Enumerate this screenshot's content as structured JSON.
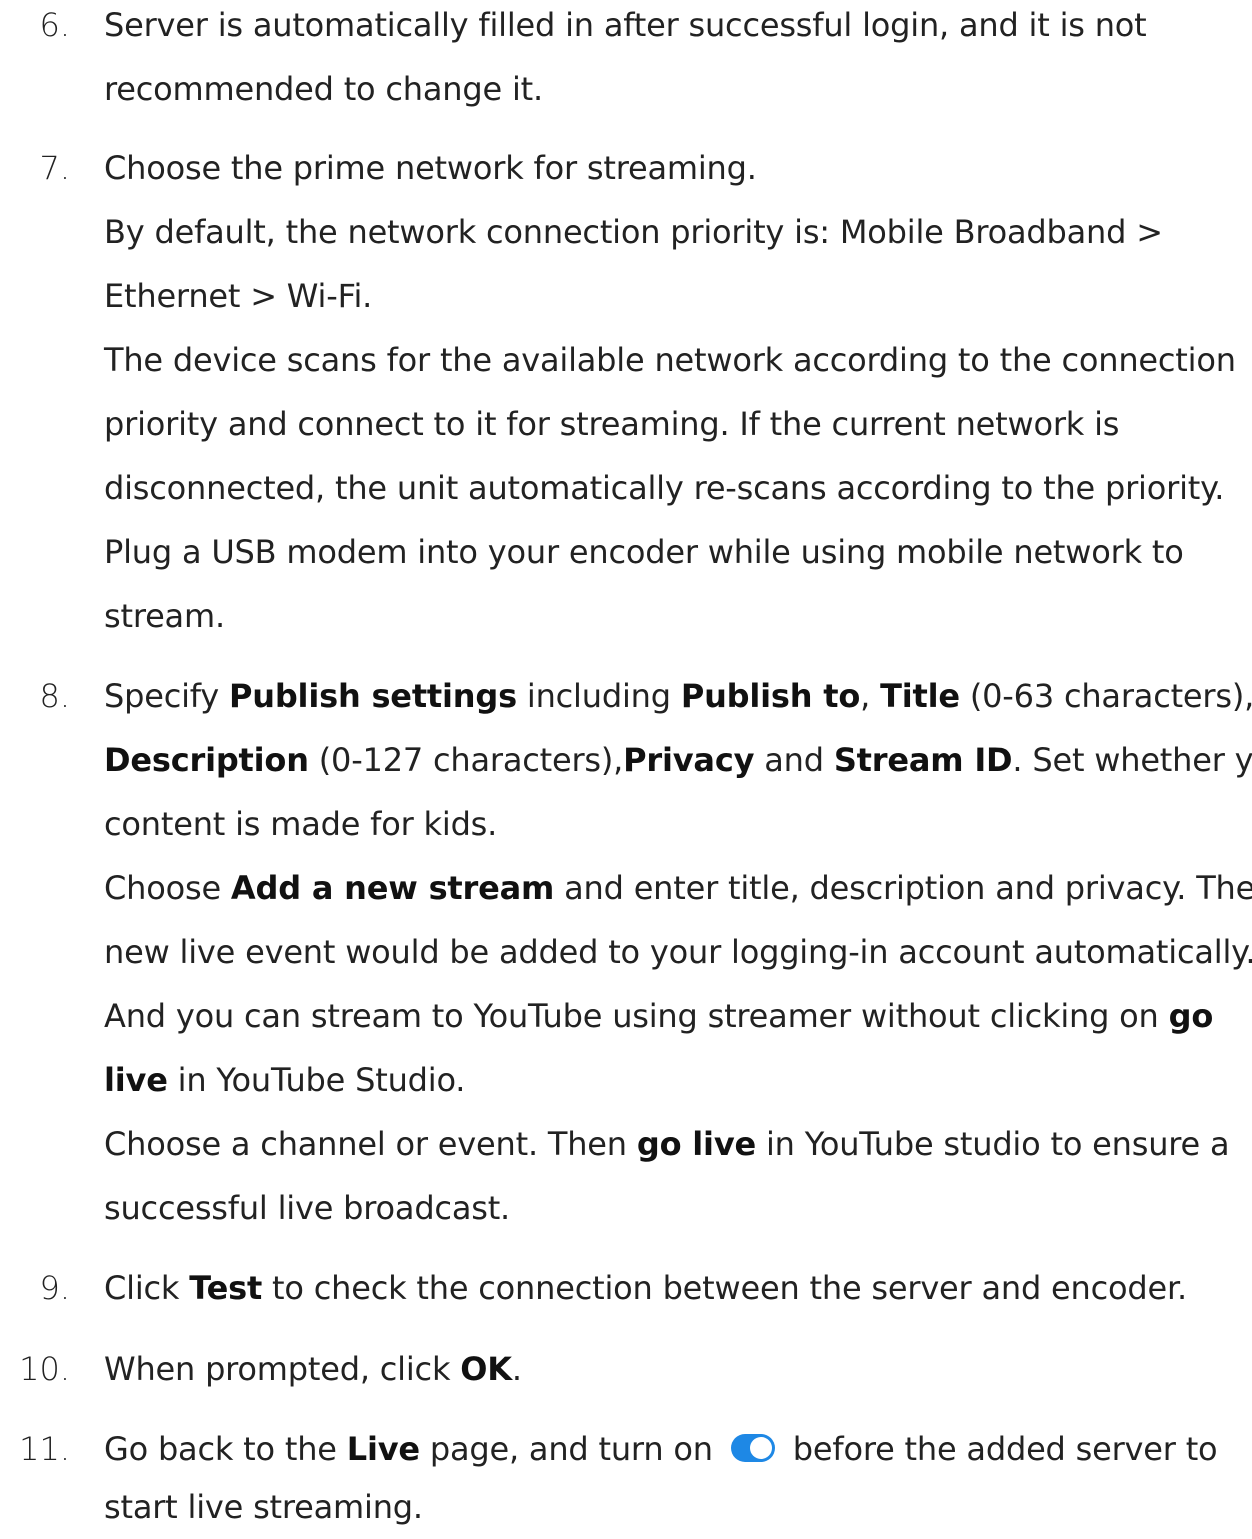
{
  "steps": [
    {
      "number": "6.",
      "lines": [
        {
          "text": "Server is automatically filled in after successful login, and it is not"
        },
        {
          "text": "recommended to change it."
        }
      ]
    },
    {
      "number": "7.",
      "lines": [
        {
          "text": "Choose the prime network for streaming."
        },
        {
          "text": "By default, the network connection priority is: Mobile Broadband >"
        },
        {
          "text": "Ethernet > Wi-Fi."
        },
        {
          "text": "The device scans for the available network according to the connection"
        },
        {
          "text": "priority and connect to it for streaming. If the current network is"
        },
        {
          "text": "disconnected, the unit automatically re-scans according to the priority."
        },
        {
          "text": "Plug a USB modem into your encoder while using mobile network to"
        },
        {
          "text": "stream."
        }
      ]
    },
    {
      "number": "8.",
      "lines": [
        {
          "p1": "Specify ",
          "b1": "Publish settings",
          "p2": " including ",
          "b2": "Publish to",
          "p3": ", ",
          "b3": "Title",
          "p4": " (0-63 characters),"
        },
        {
          "b1": "Description",
          "p1": " (0-127 characters),",
          "b2": "Privacy",
          "p2": " and ",
          "b3": "Stream ID",
          "p3": ". Set whether your"
        },
        {
          "text": "content is made for kids."
        },
        {
          "p1": "Choose ",
          "b1": "Add a new stream",
          "p2": " and enter title, description and privacy. Then a"
        },
        {
          "text": "new live event would be added to your logging-in account automatically."
        },
        {
          "p1": "And you can stream to YouTube using streamer without clicking on ",
          "b1": "go"
        },
        {
          "b1": "live",
          "p1": " in YouTube Studio."
        },
        {
          "p1": "Choose a channel or event. Then ",
          "b1": "go live",
          "p2": " in YouTube studio to ensure a"
        },
        {
          "text": "successful live broadcast."
        }
      ]
    },
    {
      "number": "9.",
      "lines": [
        {
          "p1": "Click ",
          "b1": "Test",
          "p2": " to check the connection between the server and encoder."
        }
      ]
    },
    {
      "number": "10.",
      "lines": [
        {
          "p1": "When prompted, click ",
          "b1": "OK",
          "p2": "."
        }
      ]
    },
    {
      "number": "11.",
      "lines": [
        {
          "p1": "Go back to the ",
          "b1": "Live",
          "p2": " page, and turn on ",
          "p3": " before the added server to"
        },
        {
          "text": "start live streaming."
        }
      ]
    }
  ],
  "colors": {
    "toggle_on": "#1e88e5"
  },
  "icons": {
    "toggle": "toggle-switch-on-icon"
  }
}
